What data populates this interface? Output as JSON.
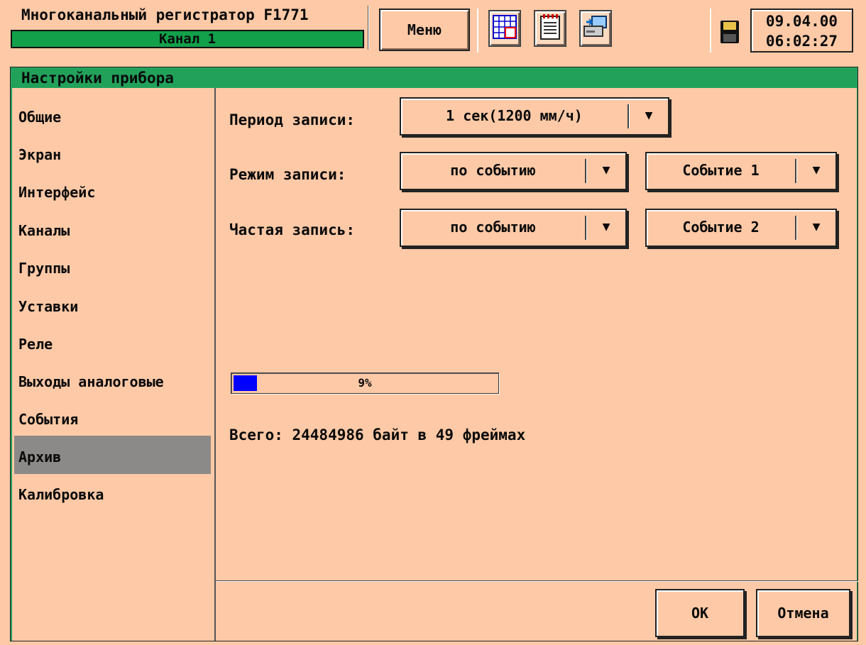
{
  "header": {
    "title": "Многоканальный регистратор F1771",
    "channel": "Канал 1",
    "menu_label": "Меню",
    "date": "09.04.00",
    "time": "06:02:27"
  },
  "toolbar_icons": [
    "table-icon",
    "notepad-icon",
    "computer-icon",
    "floppy-disk-icon"
  ],
  "dialog": {
    "title": "Настройки прибора",
    "nav": [
      {
        "label": "Общие"
      },
      {
        "label": "Экран"
      },
      {
        "label": "Интерфейс"
      },
      {
        "label": "Каналы"
      },
      {
        "label": "Группы"
      },
      {
        "label": "Уставки"
      },
      {
        "label": "Реле"
      },
      {
        "label": "Выходы аналоговые"
      },
      {
        "label": "События"
      },
      {
        "label": "Архив",
        "selected": true
      },
      {
        "label": "Калибровка"
      }
    ],
    "form": {
      "period_label": "Период записи:",
      "period_value": "1 сек(1200 мм/ч)",
      "mode_label": "Режим записи:",
      "mode_value": "по событию",
      "mode_event": "Событие 1",
      "frequent_label": "Частая запись:",
      "frequent_value": "по событию",
      "frequent_event": "Событие 2"
    },
    "progress": {
      "percent": 9,
      "text": "9%"
    },
    "summary": "Всего: 24484986 байт в 49 фреймах",
    "ok_label": "OK",
    "cancel_label": "Отмена"
  },
  "colors": {
    "background": "#fdc9a6",
    "accent_green": "#22a15b",
    "progress_blue": "#0000ff",
    "selected_gray": "#8c8a88"
  }
}
